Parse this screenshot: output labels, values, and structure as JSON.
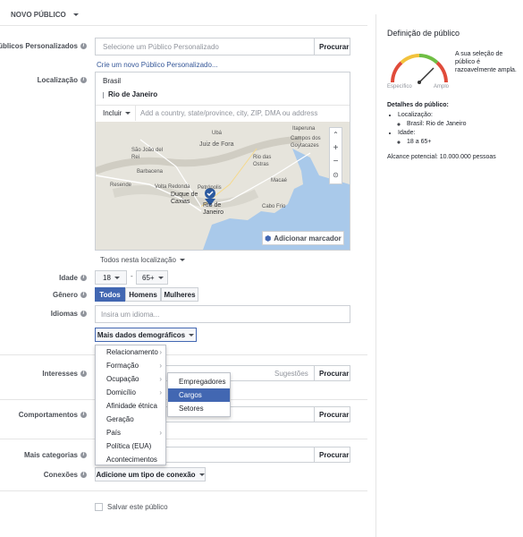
{
  "header": {
    "title": "NOVO PÚBLICO"
  },
  "custom_audiences": {
    "label": "Públicos Personalizados",
    "placeholder": "Selecione um Público Personalizado",
    "browse": "Procurar",
    "create_link": "Crie um novo Público Personalizado..."
  },
  "location": {
    "label": "Localização",
    "country": "Brasil",
    "city": "Rio de Janeiro",
    "include": "Incluir",
    "placeholder": "Add a country, state/province, city, ZIP, DMA ou address",
    "add_pin": "Adicionar marcador",
    "everyone": "Todos nesta localização"
  },
  "map": {
    "labels": [
      "Juiz de Fora",
      "Campos dos Goytacazes",
      "Rio das Ostras",
      "Macaé",
      "Cabo Frio",
      "Barbacena",
      "Rio de Janeiro",
      "Resende",
      "Volta Redonda",
      "Duque de Caxias",
      "Petrópolis",
      "Ubá",
      "São João del Rei",
      "Itaperuna"
    ]
  },
  "age": {
    "label": "Idade",
    "min": "18",
    "max": "65+"
  },
  "gender": {
    "label": "Gênero",
    "options": [
      "Todos",
      "Homens",
      "Mulheres"
    ]
  },
  "languages": {
    "label": "Idiomas",
    "placeholder": "Insira um idioma..."
  },
  "demographics": {
    "button": "Mais dados demográficos",
    "menu": [
      "Relacionamento",
      "Formação",
      "Ocupação",
      "Domicílio",
      "Afinidade étnica",
      "Geração",
      "País",
      "Política (EUA)",
      "Acontecimentos"
    ],
    "submenu": [
      "Empregadores",
      "Cargos",
      "Setores"
    ]
  },
  "interests": {
    "label": "Interesses",
    "suggestions": "Sugestões",
    "browse": "Procurar"
  },
  "behaviors": {
    "label": "Comportamentos",
    "browse": "Procurar"
  },
  "more_categories": {
    "label": "Mais categorias",
    "browse": "Procurar"
  },
  "connections": {
    "label": "Conexões",
    "button": "Adicione um tipo de conexão"
  },
  "save": {
    "label": "Salvar este público"
  },
  "definition": {
    "title": "Definição de público",
    "gauge_specific": "Específico",
    "gauge_broad": "Amplo",
    "description": "A sua seleção de público é razoavelmente ampla.",
    "details_title": "Detalhes do público:",
    "loc_label": "Localização:",
    "loc_value": "Brasil: Rio de Janeiro",
    "age_label": "Idade:",
    "age_value": "18 a 65+",
    "reach": "Alcance potencial: 10.000.000 pessoas"
  }
}
